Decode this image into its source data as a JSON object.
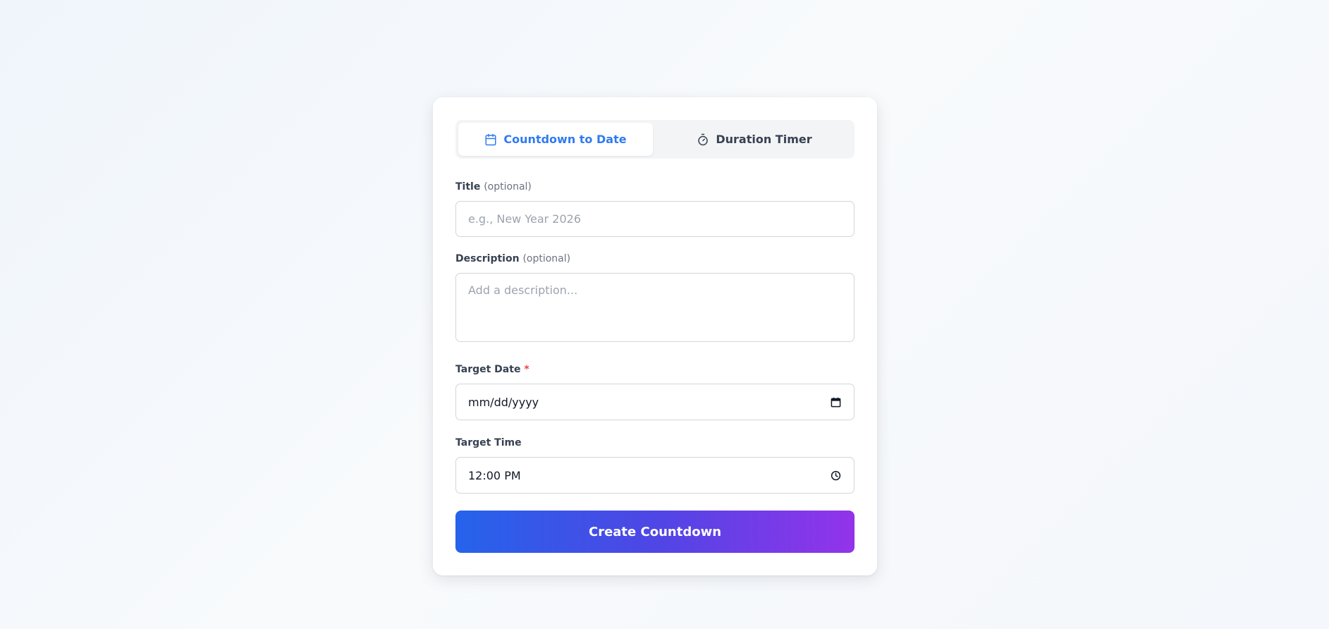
{
  "tabs": [
    {
      "label": "Countdown to Date",
      "icon": "calendar-icon",
      "active": true
    },
    {
      "label": "Duration Timer",
      "icon": "stopwatch-icon",
      "active": false
    }
  ],
  "form": {
    "title": {
      "label": "Title",
      "optional": "(optional)",
      "placeholder": "e.g., New Year 2026",
      "value": ""
    },
    "description": {
      "label": "Description",
      "optional": "(optional)",
      "placeholder": "Add a description...",
      "value": ""
    },
    "target_date": {
      "label": "Target Date",
      "required_mark": "*",
      "value": "mm/dd/yyyy",
      "icon": "calendar-icon"
    },
    "target_time": {
      "label": "Target Time",
      "value": "12:00 PM",
      "icon": "clock-icon"
    },
    "submit_label": "Create Countdown"
  },
  "colors": {
    "accent": "#2f7bf0",
    "required": "#ef4444",
    "button_gradient_start": "#2563eb",
    "button_gradient_end": "#9333ea"
  }
}
